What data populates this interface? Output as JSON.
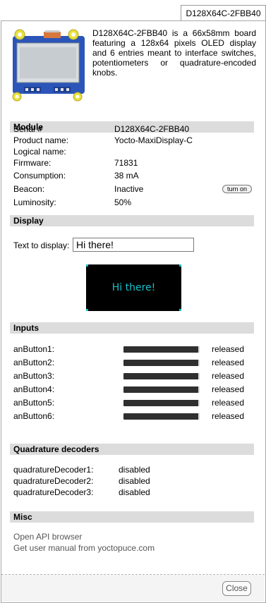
{
  "tab": {
    "label": "D128X64C-2FBB40"
  },
  "description": "D128X64C-2FBB40 is a 66x58mm board featuring a 128x64 pixels OLED display and 6 entries meant to interface switches, potentiometers or quadrature-encoded knobs.",
  "module": {
    "title": "Module",
    "rows": [
      {
        "label": "Serial #",
        "value": "D128X64C-2FBB40"
      },
      {
        "label": "Product name:",
        "value": "Yocto-MaxiDisplay-C"
      },
      {
        "label": "Logical name:",
        "value": ""
      },
      {
        "label": "Firmware:",
        "value": "71831"
      },
      {
        "label": "Consumption:",
        "value": "38 mA"
      },
      {
        "label": "Beacon:",
        "value": "Inactive"
      },
      {
        "label": "Luminosity:",
        "value": "50%"
      }
    ],
    "beacon_button": "turn on"
  },
  "display": {
    "title": "Display",
    "text_label": "Text to display:",
    "text_value": "Hi there!",
    "screen_text": "Hi there!"
  },
  "inputs": {
    "title": "Inputs",
    "items": [
      {
        "label": "anButton1:",
        "level": 0.98,
        "state": "released"
      },
      {
        "label": "anButton2:",
        "level": 0.98,
        "state": "released"
      },
      {
        "label": "anButton3:",
        "level": 0.98,
        "state": "released"
      },
      {
        "label": "anButton4:",
        "level": 0.98,
        "state": "released"
      },
      {
        "label": "anButton5:",
        "level": 0.98,
        "state": "released"
      },
      {
        "label": "anButton6:",
        "level": 0.98,
        "state": "released"
      }
    ]
  },
  "quadrature": {
    "title": "Quadrature decoders",
    "items": [
      {
        "label": "quadratureDecoder1:",
        "value": "disabled"
      },
      {
        "label": "quadratureDecoder2:",
        "value": "disabled"
      },
      {
        "label": "quadratureDecoder3:",
        "value": "disabled"
      }
    ]
  },
  "misc": {
    "title": "Misc",
    "links": [
      "Open API browser",
      "Get user manual from yoctopuce.com"
    ]
  },
  "footer": {
    "close_label": "Close"
  },
  "colors": {
    "oled_text": "#19c0c8",
    "section_bg": "#dcdcdc",
    "bar": "#2f2f2f"
  }
}
